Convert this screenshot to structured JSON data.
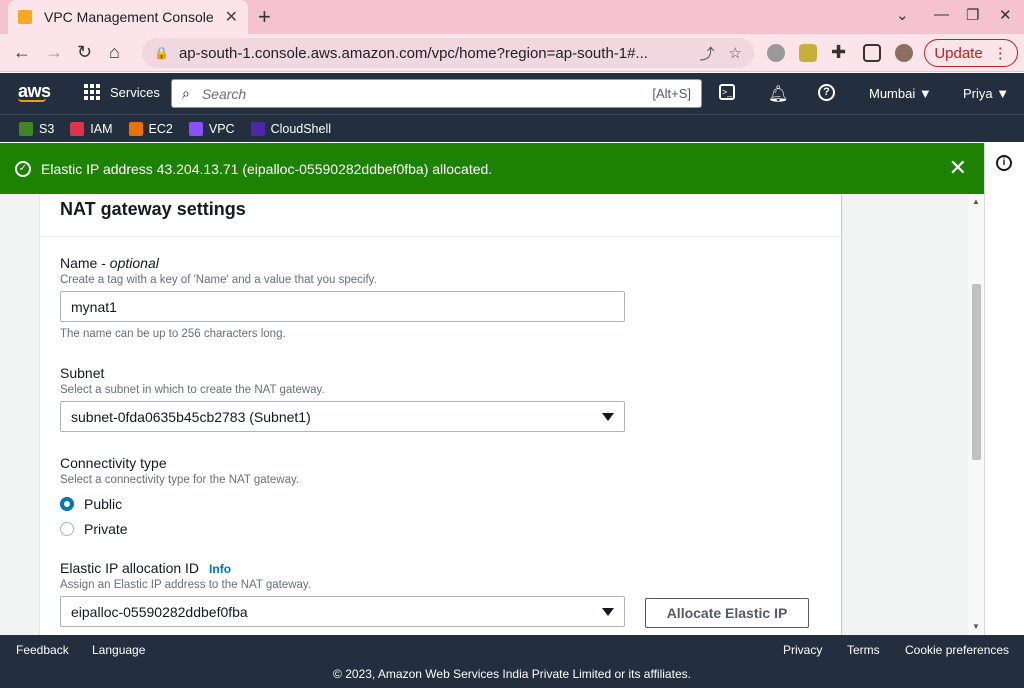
{
  "browser": {
    "tab_title": "VPC Management Console",
    "url": "ap-south-1.console.aws.amazon.com/vpc/home?region=ap-south-1#...",
    "update_label": "Update"
  },
  "aws": {
    "services_label": "Services",
    "search_placeholder": "Search",
    "search_shortcut": "[Alt+S]",
    "region": "Mumbai",
    "user": "Priya",
    "favorites": [
      {
        "label": "S3",
        "color": "#3f8624"
      },
      {
        "label": "IAM",
        "color": "#dd344c"
      },
      {
        "label": "EC2",
        "color": "#ed7100"
      },
      {
        "label": "VPC",
        "color": "#8c4fff"
      },
      {
        "label": "CloudShell",
        "color": "#4d27aa"
      }
    ]
  },
  "flash": {
    "message": "Elastic IP address 43.204.13.71 (eipalloc-05590282ddbef0fba) allocated.",
    "color": "#1d8102"
  },
  "form": {
    "title": "NAT gateway settings",
    "name": {
      "label": "Name - ",
      "label_optional": "optional",
      "description": "Create a tag with a key of 'Name' and a value that you specify.",
      "value": "mynat1",
      "constraint": "The name can be up to 256 characters long."
    },
    "subnet": {
      "label": "Subnet",
      "description": "Select a subnet in which to create the NAT gateway.",
      "value": "subnet-0fda0635b45cb2783 (Subnet1)"
    },
    "connectivity": {
      "label": "Connectivity type",
      "description": "Select a connectivity type for the NAT gateway.",
      "options": [
        {
          "label": "Public",
          "selected": true
        },
        {
          "label": "Private",
          "selected": false
        }
      ]
    },
    "eip": {
      "label": "Elastic IP allocation ID",
      "info": "Info",
      "description": "Assign an Elastic IP address to the NAT gateway.",
      "value": "eipalloc-05590282ddbef0fba",
      "allocate_button": "Allocate Elastic IP"
    }
  },
  "footer": {
    "feedback": "Feedback",
    "language": "Language",
    "privacy": "Privacy",
    "terms": "Terms",
    "cookies": "Cookie preferences",
    "copyright": "© 2023, Amazon Web Services India Private Limited or its affiliates."
  }
}
